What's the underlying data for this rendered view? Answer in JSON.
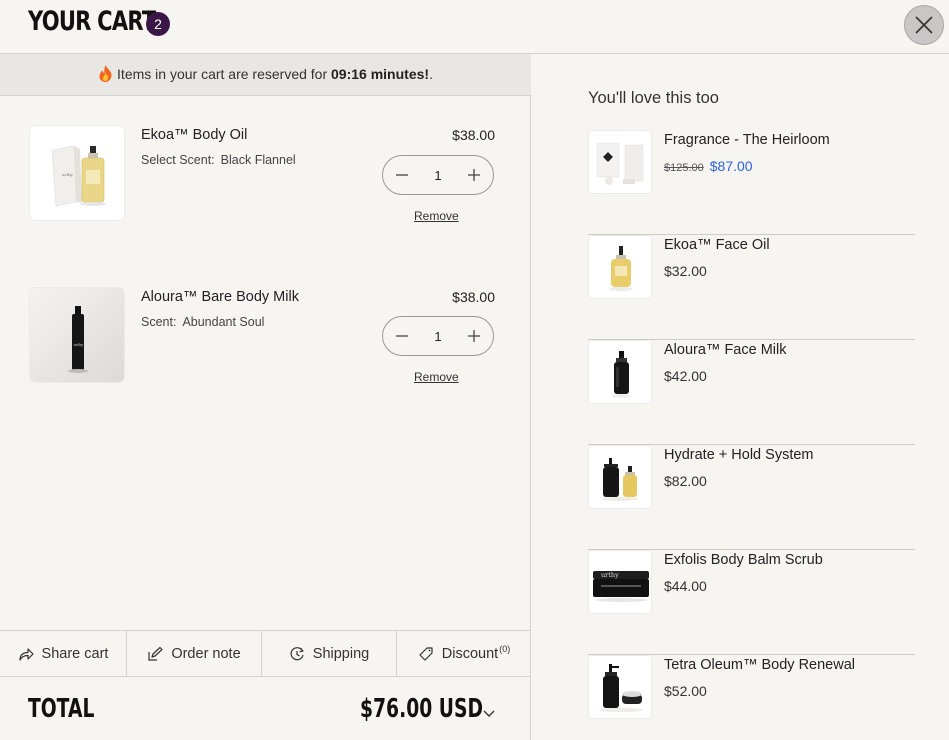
{
  "header": {
    "title": "YOUR CART",
    "count": "2"
  },
  "banner": {
    "icon": "fire-icon",
    "prefix": "Items in your cart are reserved for",
    "timer": "09:16 minutes!",
    "suffix": "."
  },
  "items": [
    {
      "name": "Ekoa™ Body Oil",
      "variant_label": "Select Scent:",
      "variant_value": "Black Flannel",
      "price": "$38.00",
      "quantity": "1",
      "remove_label": "Remove"
    },
    {
      "name": "Aloura™ Bare Body Milk",
      "variant_label": "Scent:",
      "variant_value": "Abundant Soul",
      "price": "$38.00",
      "quantity": "1",
      "remove_label": "Remove"
    }
  ],
  "footer_tabs": {
    "share": "Share cart",
    "note": "Order note",
    "shipping": "Shipping",
    "discount": "Discount",
    "discount_count": "(0)"
  },
  "total": {
    "label": "TOTAL",
    "value": "$76.00 USD"
  },
  "recommendations": {
    "title": "You'll love this too",
    "items": [
      {
        "name": "Fragrance - The Heirloom",
        "compare_price": "$125.00",
        "price": "$87.00"
      },
      {
        "name": "Ekoa™ Face Oil",
        "price": "$32.00"
      },
      {
        "name": "Aloura™ Face Milk",
        "price": "$42.00"
      },
      {
        "name": "Hydrate + Hold System",
        "price": "$82.00"
      },
      {
        "name": "Exfolis Body Balm Scrub",
        "price": "$44.00"
      },
      {
        "name": "Tetra Oleum™ Body Renewal",
        "price": "$52.00"
      }
    ]
  },
  "colors": {
    "badge": "#3a1747",
    "sale_price": "#2f62d8",
    "background": "#f7f5f2",
    "banner_bg": "#e9e7e4"
  }
}
